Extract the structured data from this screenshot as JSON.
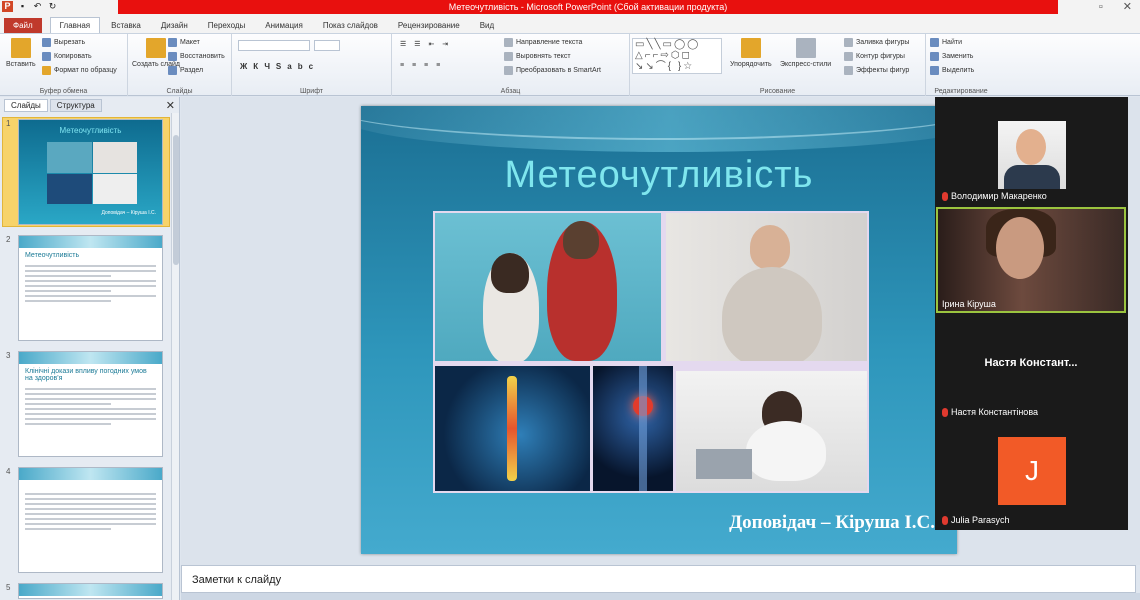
{
  "window": {
    "title": "Метеочутливість - Microsoft PowerPoint (Сбой активации продукта)"
  },
  "ribbon": {
    "tabs": [
      "Файл",
      "Главная",
      "Вставка",
      "Дизайн",
      "Переходы",
      "Анимация",
      "Показ слайдов",
      "Рецензирование",
      "Вид"
    ],
    "active_tab": "Главная",
    "groups": {
      "clipboard": {
        "title": "Буфер обмена",
        "paste": "Вставить",
        "cut": "Вырезать",
        "copy": "Копировать",
        "format_painter": "Формат по образцу"
      },
      "slides": {
        "title": "Слайды",
        "new_slide": "Создать слайд",
        "layout": "Макет",
        "reset": "Восстановить",
        "section": "Раздел"
      },
      "font": {
        "title": "Шрифт"
      },
      "paragraph": {
        "title": "Абзац",
        "text_direction": "Направление текста",
        "align_text": "Выровнять текст",
        "convert_smartart": "Преобразовать в SmartArt"
      },
      "drawing": {
        "title": "Рисование",
        "arrange": "Упорядочить",
        "quick_styles": "Экспресс-стили",
        "shape_fill": "Заливка фигуры",
        "shape_outline": "Контур фигуры",
        "shape_effects": "Эффекты фигур"
      },
      "editing": {
        "title": "Редактирование",
        "find": "Найти",
        "replace": "Заменить",
        "select": "Выделить"
      }
    }
  },
  "left_panel": {
    "tabs": [
      "Слайды",
      "Структура"
    ],
    "slide_numbers": [
      "1",
      "2",
      "3",
      "4",
      "5"
    ],
    "thumb_titles": {
      "s1": "Метеочутливість",
      "s2": "Метеочутливість",
      "s3": "Клінічні докази впливу погодних умов на здоров'я"
    }
  },
  "slide": {
    "title": "Метеочутливість",
    "presenter": "Доповідач – Кіруша І.С."
  },
  "notes": {
    "placeholder": "Заметки к слайду"
  },
  "participants": [
    {
      "name": "Володимир Макаренко",
      "type": "photo",
      "muted": true
    },
    {
      "name": "Ірина Кіруша",
      "type": "video",
      "muted": false
    },
    {
      "name": "Настя Константінова",
      "display": "Настя  Констант...",
      "type": "name",
      "muted": true
    },
    {
      "name": "Julia Parasych",
      "initial": "J",
      "type": "initial",
      "muted": true
    }
  ],
  "colors": {
    "title_bar": "#e8100e",
    "slide_title": "#7fe6ee",
    "zoom_bg": "#1a1a1a",
    "active_speaker_border": "#9bc43f",
    "avatar_orange": "#f25a27"
  }
}
